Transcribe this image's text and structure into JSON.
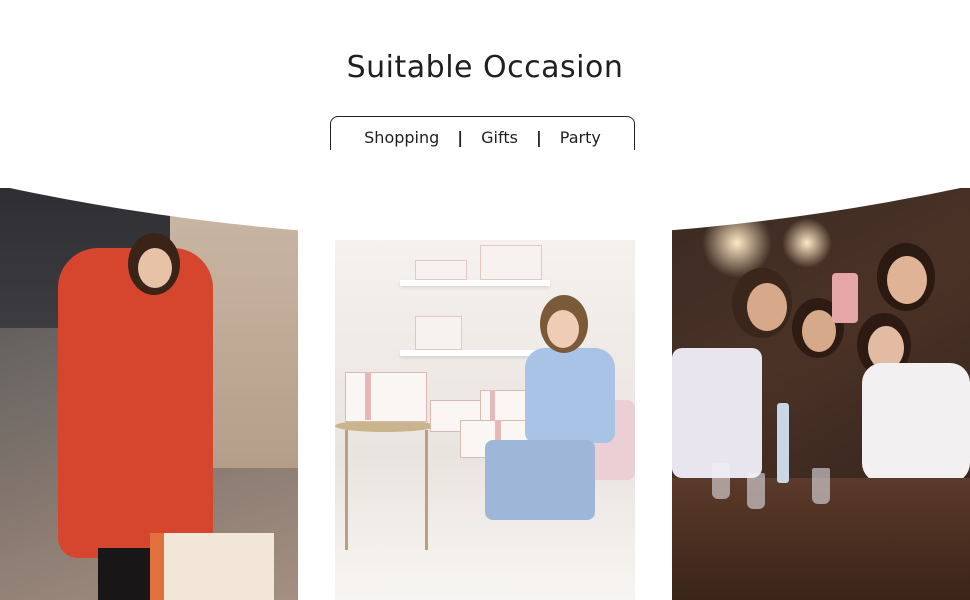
{
  "heading": "Suitable Occasion",
  "occasions": [
    "Shopping",
    "Gifts",
    "Party"
  ],
  "separator": "|",
  "colors": {
    "text": "#1f1f1f",
    "border": "#222222",
    "background": "#ffffff"
  }
}
